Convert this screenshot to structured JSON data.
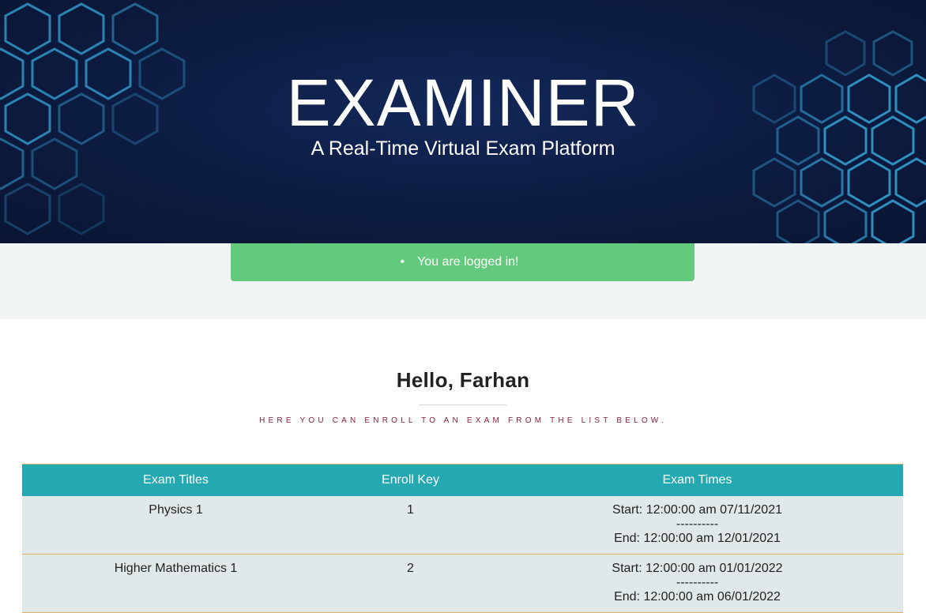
{
  "banner": {
    "title": "EXAMINER",
    "subtitle": "A Real-Time Virtual Exam Platform"
  },
  "alert": {
    "bullet": "•",
    "message": "You are logged in!",
    "color": "#63c97c"
  },
  "main": {
    "greeting": "Hello, Farhan",
    "subtitle": "Here you can enroll to an exam from the list below."
  },
  "table": {
    "headers": [
      "Exam Titles",
      "Enroll Key",
      "Exam Times"
    ],
    "rows": [
      {
        "title": "Physics 1",
        "key": "1",
        "start": "Start: 12:00:00 am 07/11/2021",
        "sep": "----------",
        "end": "End: 12:00:00 am 12/01/2021"
      },
      {
        "title": "Higher Mathematics 1",
        "key": "2",
        "start": "Start: 12:00:00 am 01/01/2022",
        "sep": "----------",
        "end": "End: 12:00:00 am 06/01/2022"
      }
    ]
  },
  "colors": {
    "banner_bg": "#0d1d44",
    "header_bg": "#24a8b2",
    "row_bg": "#e1e8e9",
    "row_border": "#d9b26c",
    "subtitle_text": "#8a1f3b"
  }
}
